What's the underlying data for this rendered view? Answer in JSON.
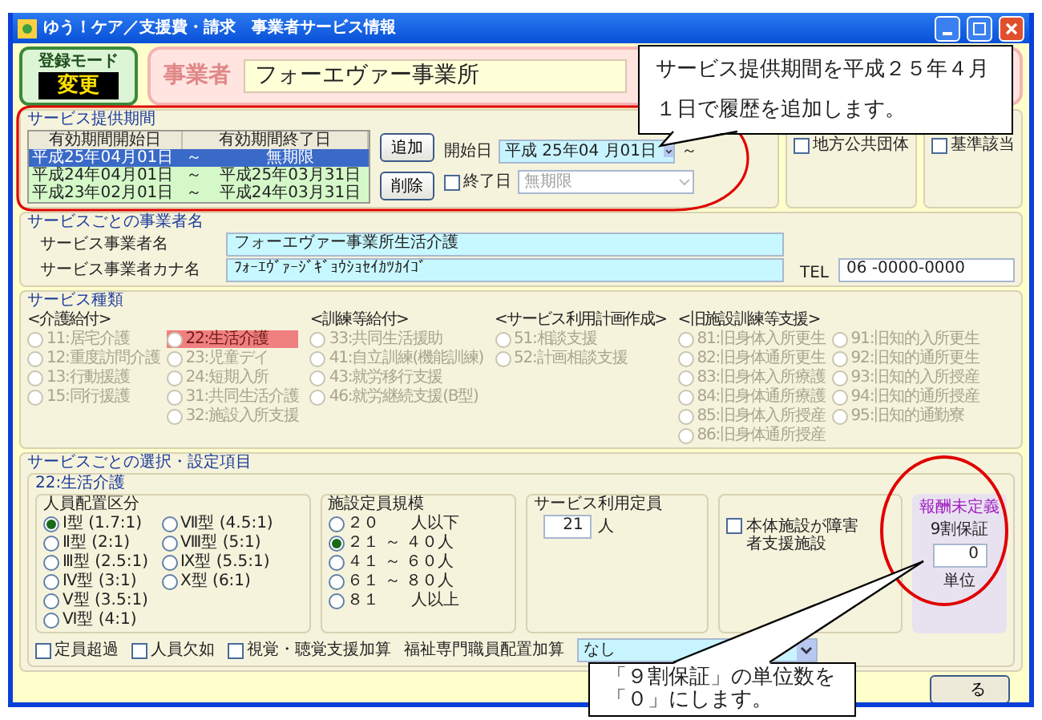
{
  "window": {
    "title": "ゆう！ケア／支援費・請求　事業者サービス情報"
  },
  "mode": {
    "label": "登録モード",
    "value": "変更"
  },
  "provider": {
    "label": "事業者",
    "name": "フォーエヴァー事業所"
  },
  "service_period": {
    "title": "サービス提供期間",
    "columns": [
      "有効期間開始日",
      "有効期間終了日"
    ],
    "rows": [
      {
        "start": "平成25年04月01日",
        "separator": "～",
        "end": "無期限",
        "selected": true
      },
      {
        "start": "平成24年04月01日",
        "separator": "～",
        "end": "平成25年03月31日",
        "selected": false
      },
      {
        "start": "平成23年02月01日",
        "separator": "～",
        "end": "平成24年03月31日",
        "selected": false
      }
    ],
    "buttons": [
      "追加",
      "削除"
    ],
    "start_label": "開始日",
    "start_value": "平成 25年04 月01日",
    "start_suffix": "～",
    "end_checkbox": {
      "label": "終了日",
      "checked": false
    },
    "end_value": "無期限",
    "end_disabled": true
  },
  "flags": [
    {
      "label": "地方公共団体",
      "checked": false
    },
    {
      "label": "基準該当",
      "checked": false
    }
  ],
  "names": {
    "title": "サービスごとの事業者名",
    "fields": [
      {
        "label": "サービス事業者名",
        "value": "フォーエヴァー事業所生活介護"
      },
      {
        "label": "サービス事業者カナ名",
        "value": "ﾌｫｰｴｳﾞｧｰｼﾞｷﾞｮｳｼｮｾｲｶﾂｶｲｺﾞ"
      }
    ],
    "tel": {
      "label": "TEL",
      "value": "06  -0000-0000"
    }
  },
  "service_types": {
    "title": "サービス種類",
    "disabled": true,
    "categories": [
      {
        "heading": "<介護給付>",
        "columns": [
          [
            {
              "label": "11:居宅介護",
              "selected": false
            },
            {
              "label": "12:重度訪問介護",
              "selected": false
            },
            {
              "label": "13:行動援護",
              "selected": false
            },
            {
              "label": "15:同行援護",
              "selected": false
            }
          ],
          [
            {
              "label": "22:生活介護",
              "selected": true
            },
            {
              "label": "23:児童デイ",
              "selected": false
            },
            {
              "label": "24:短期入所",
              "selected": false
            },
            {
              "label": "31:共同生活介護",
              "selected": false
            },
            {
              "label": "32:施設入所支援",
              "selected": false
            }
          ]
        ]
      },
      {
        "heading": "<訓練等給付>",
        "columns": [
          [
            {
              "label": "33:共同生活援助",
              "selected": false
            },
            {
              "label": "41:自立訓練(機能訓練)",
              "selected": false
            },
            {
              "label": "43:就労移行支援",
              "selected": false
            },
            {
              "label": "46:就労継続支援(B型)",
              "selected": false
            }
          ]
        ]
      },
      {
        "heading": "<サービス利用計画作成>",
        "columns": [
          [
            {
              "label": "51:相談支援",
              "selected": false
            },
            {
              "label": "52:計画相談支援",
              "selected": false
            }
          ]
        ]
      },
      {
        "heading": "<旧施設訓練等支援>",
        "columns": [
          [
            {
              "label": "81:旧身体入所更生",
              "selected": false
            },
            {
              "label": "82:旧身体通所更生",
              "selected": false
            },
            {
              "label": "83:旧身体入所療護",
              "selected": false
            },
            {
              "label": "84:旧身体通所療護",
              "selected": false
            },
            {
              "label": "85:旧身体入所授産",
              "selected": false
            },
            {
              "label": "86:旧身体通所授産",
              "selected": false
            }
          ],
          [
            {
              "label": "91:旧知的入所更生",
              "selected": false
            },
            {
              "label": "92:旧知的通所更生",
              "selected": false
            },
            {
              "label": "93:旧知的入所授産",
              "selected": false
            },
            {
              "label": "94:旧知的通所授産",
              "selected": false
            },
            {
              "label": "95:旧知的通勤寮",
              "selected": false
            }
          ]
        ]
      }
    ]
  },
  "settings": {
    "title": "サービスごとの選択・設定項目",
    "service": "22:生活介護",
    "staffing": {
      "title": "人員配置区分",
      "columns": [
        [
          {
            "label": "Ⅰ型 (1.7:1)",
            "selected": true
          },
          {
            "label": "Ⅱ型 (2:1)",
            "selected": false
          },
          {
            "label": "Ⅲ型 (2.5:1)",
            "selected": false
          },
          {
            "label": "Ⅳ型 (3:1)",
            "selected": false
          },
          {
            "label": "Ⅴ型 (3.5:1)",
            "selected": false
          },
          {
            "label": "Ⅵ型 (4:1)",
            "selected": false
          }
        ],
        [
          {
            "label": "Ⅶ型 (4.5:1)",
            "selected": false
          },
          {
            "label": "Ⅷ型 (5:1)",
            "selected": false
          },
          {
            "label": "Ⅸ型 (5.5:1)",
            "selected": false
          },
          {
            "label": "Ⅹ型 (6:1)",
            "selected": false
          }
        ]
      ]
    },
    "capacity_scale": {
      "title": "施設定員規模",
      "options": [
        {
          "label": "２０",
          "suffix": "人以下",
          "selected": false
        },
        {
          "label": "２１ ～ ４０人",
          "selected": true
        },
        {
          "label": "４１ ～ ６０人",
          "selected": false
        },
        {
          "label": "６１ ～ ８０人",
          "selected": false
        },
        {
          "label": "８１",
          "suffix": "人以上",
          "selected": false
        }
      ]
    },
    "capacity": {
      "title": "サービス利用定員",
      "value": "21",
      "unit": "人"
    },
    "main_facility": {
      "label": "本体施設が障害者支援施設",
      "checked": false
    },
    "guarantee": {
      "title": "報酬未定義",
      "label": "9割保証",
      "value": "0",
      "unit": "単位"
    },
    "extras": [
      {
        "label": "定員超過",
        "checked": false
      },
      {
        "label": "人員欠如",
        "checked": false
      },
      {
        "label": "視覚・聴覚支援加算",
        "checked": false
      }
    ],
    "welfare": {
      "label": "福祉専門職員配置加算",
      "value": "なし"
    }
  },
  "footer_button": "る",
  "callouts": [
    {
      "text": "サービス提供期間を平成２５年４月１日で履歴を追加します。"
    },
    {
      "text": "「９割保証」の単位数を「０」にします。"
    }
  ]
}
